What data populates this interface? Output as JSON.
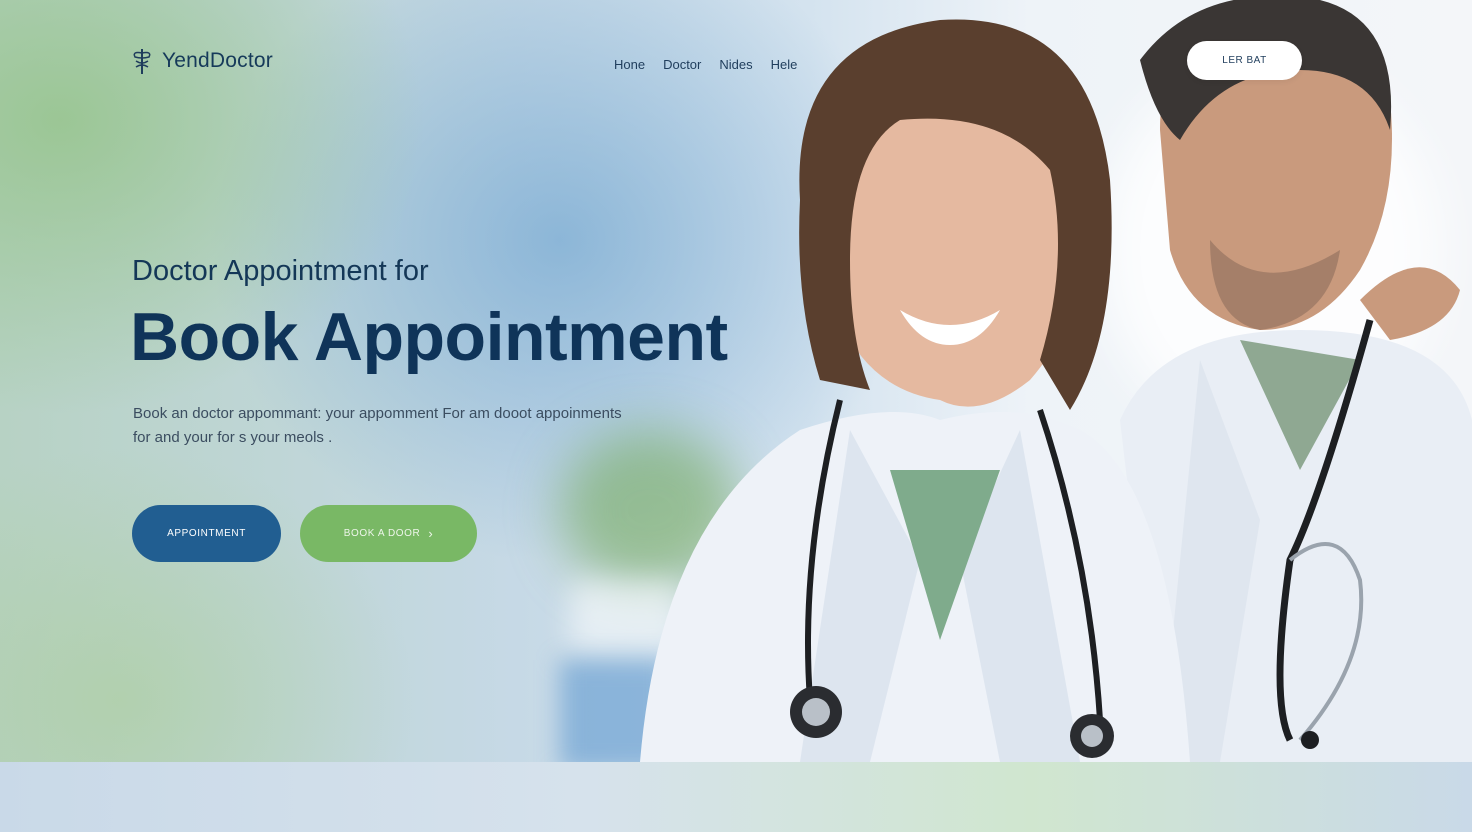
{
  "brand": {
    "name": "YendDoctor",
    "icon": "caduceus-icon"
  },
  "nav": {
    "items": [
      "Hone",
      "Doctor",
      "Nides",
      "Hele"
    ]
  },
  "header_cta": {
    "label": "LER BAT"
  },
  "hero": {
    "subheading": "Doctor Appointment for",
    "headline": "Book Appointment",
    "description_lines": [
      "Book an doctor appommant: your appomment For am dooot appoinments",
      "for and your for s your meols ."
    ],
    "primary_button": "APPOINTMENT",
    "secondary_button": "BOOK A DOOR",
    "secondary_button_icon": "chevron-right-icon"
  },
  "colors": {
    "brand_dark": "#0f3459",
    "primary_button": "#215e91",
    "secondary_button": "#79b865"
  }
}
